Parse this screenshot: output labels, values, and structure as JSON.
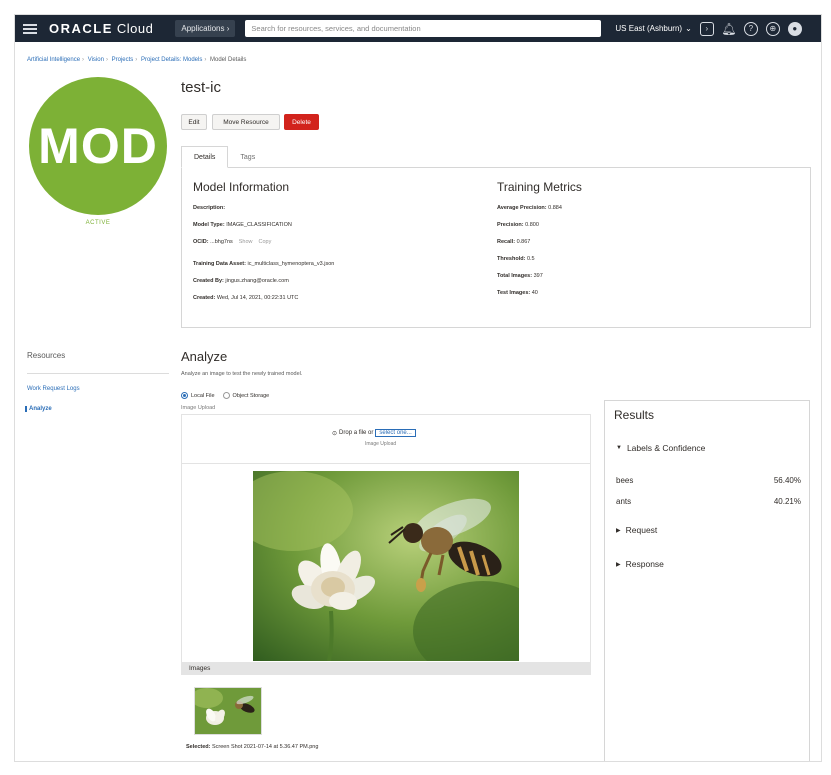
{
  "topbar": {
    "brand": "ORACLE",
    "product": "Cloud",
    "applications_label": "Applications",
    "search_placeholder": "Search for resources, services, and documentation",
    "region": "US East (Ashburn)"
  },
  "breadcrumb": {
    "items": [
      "Artificial Intelligence",
      "Vision",
      "Projects",
      "Project Details: Models",
      "Model Details"
    ]
  },
  "model": {
    "avatar_text": "MOD",
    "state": "ACTIVE",
    "name": "test-ic",
    "avatar_color": "#7db136"
  },
  "actions": {
    "edit": "Edit",
    "move": "Move Resource",
    "delete": "Delete",
    "delete_color": "#d2231c"
  },
  "tabs": [
    "Details",
    "Tags"
  ],
  "model_information": {
    "title": "Model Information",
    "fields": [
      {
        "label": "Description:",
        "value": ""
      },
      {
        "label": "Model Type:",
        "value": "IMAGE_CLASSIFICATION"
      },
      {
        "label": "OCID:",
        "value": "...bhg7ns",
        "show": "Show",
        "copy": "Copy"
      },
      {
        "label": "Training Data Asset:",
        "value": "ic_multiclass_hymenoptera_v3.json"
      },
      {
        "label": "Created By:",
        "value": "jingus.zhang@oracle.com"
      },
      {
        "label": "Created:",
        "value": "Wed, Jul 14, 2021, 00:22:31 UTC"
      }
    ]
  },
  "training_metrics": {
    "title": "Training Metrics",
    "fields": [
      {
        "label": "Average Precision:",
        "value": "0.884"
      },
      {
        "label": "Precision:",
        "value": "0.800"
      },
      {
        "label": "Recall:",
        "value": "0.867"
      },
      {
        "label": "Threshold:",
        "value": "0.5"
      },
      {
        "label": "Total Images:",
        "value": "397"
      },
      {
        "label": "Test Images:",
        "value": "40"
      }
    ]
  },
  "resources": {
    "title": "Resources",
    "links": [
      "Work Request Logs",
      "Analyze"
    ]
  },
  "analyze": {
    "title": "Analyze",
    "subtitle": "Analyze an image to test the newly trained model.",
    "source_options": [
      "Local File",
      "Object Storage"
    ],
    "upload_label": "Image Upload",
    "drop_text": "Drop a file or",
    "drop_link": "select one...",
    "drop_sub": "Image Upload",
    "images_label": "Images",
    "selected_label": "Selected:",
    "selected_file": "Screen Shot 2021-07-14 at 5.36.47 PM.png"
  },
  "results": {
    "title": "Results",
    "sections": [
      "Labels & Confidence",
      "Request",
      "Response"
    ],
    "labels": [
      {
        "name": "bees",
        "confidence": "56.40%"
      },
      {
        "name": "ants",
        "confidence": "40.21%"
      }
    ]
  }
}
